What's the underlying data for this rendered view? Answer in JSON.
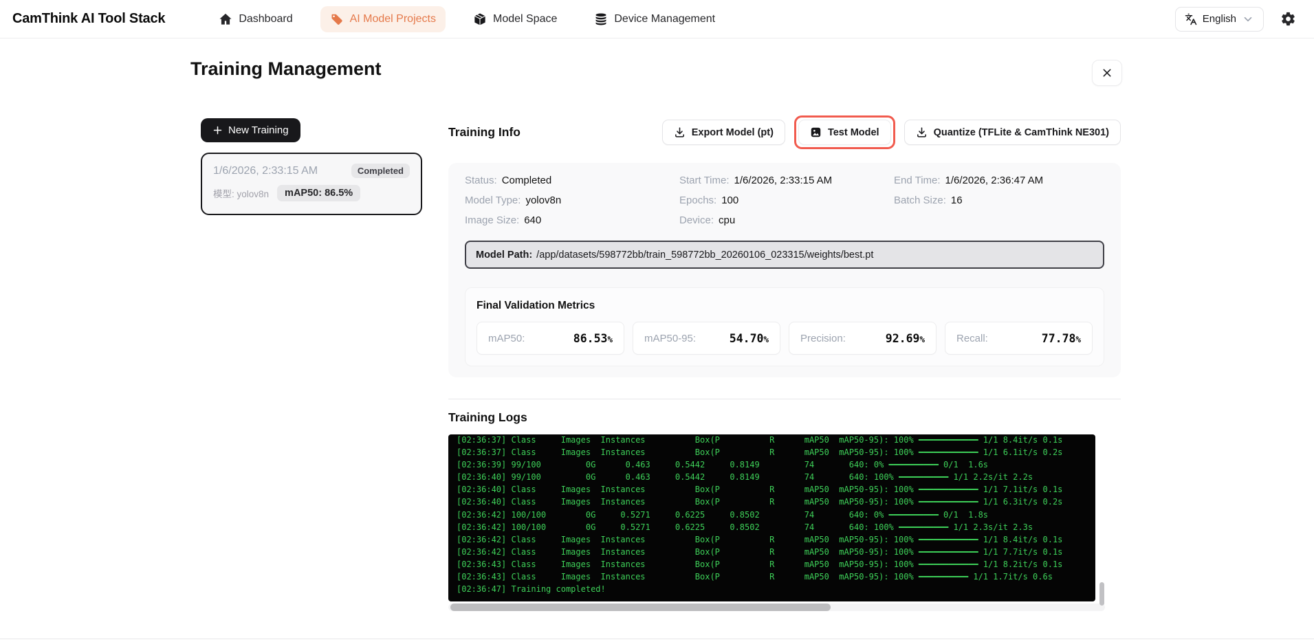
{
  "nav": {
    "logo": "CamThink AI Tool Stack",
    "items": [
      {
        "label": "Dashboard",
        "icon": "home-icon",
        "active": false
      },
      {
        "label": "AI Model Projects",
        "icon": "tag-icon",
        "active": true
      },
      {
        "label": "Model Space",
        "icon": "package-icon",
        "active": false
      },
      {
        "label": "Device Management",
        "icon": "database-icon",
        "active": false
      }
    ],
    "language": {
      "label": "English",
      "icon": "translate-icon"
    }
  },
  "page": {
    "title": "Training Management"
  },
  "icons": {
    "plus": "+",
    "close": "✕"
  },
  "sidebar": {
    "new_training_label": "New Training",
    "training_item": {
      "timestamp": "1/6/2026, 2:33:15 AM",
      "status": "Completed",
      "model_label": "模型: yolov8n",
      "map_badge": "mAP50: 86.5%"
    }
  },
  "training_info": {
    "title": "Training Info",
    "buttons": {
      "export": "Export Model (pt)",
      "test": "Test Model",
      "quantize": "Quantize (TFLite & CamThink NE301)"
    },
    "fields": [
      {
        "label": "Status:",
        "value": "Completed"
      },
      {
        "label": "Start Time:",
        "value": "1/6/2026, 2:33:15 AM"
      },
      {
        "label": "End Time:",
        "value": "1/6/2026, 2:36:47 AM"
      },
      {
        "label": "Model Type:",
        "value": "yolov8n"
      },
      {
        "label": "Epochs:",
        "value": "100"
      },
      {
        "label": "Batch Size:",
        "value": "16"
      },
      {
        "label": "Image Size:",
        "value": "640"
      },
      {
        "label": "Device:",
        "value": "cpu"
      }
    ],
    "model_path_label": "Model Path:",
    "model_path": "/app/datasets/598772bb/train_598772bb_20260106_023315/weights/best.pt",
    "metrics_title": "Final Validation Metrics",
    "metrics": [
      {
        "label": "mAP50:",
        "value": "86.53",
        "unit": "%"
      },
      {
        "label": "mAP50-95:",
        "value": "54.70",
        "unit": "%"
      },
      {
        "label": "Precision:",
        "value": "92.69",
        "unit": "%"
      },
      {
        "label": "Recall:",
        "value": "77.78",
        "unit": "%"
      }
    ]
  },
  "training_logs": {
    "title": "Training Logs",
    "lines": [
      "[02:36:37] Class     Images  Instances          Box(P          R      mAP50  mAP50-95): 100% ━━━━━━━━━━━━ 1/1 8.4it/s 0.1s",
      "[02:36:37] Class     Images  Instances          Box(P          R      mAP50  mAP50-95): 100% ━━━━━━━━━━━━ 1/1 6.1it/s 0.2s",
      "[02:36:39] 99/100         0G      0.463     0.5442     0.8149         74       640: 0% ━━━━━━━━━━ 0/1  1.6s",
      "[02:36:40] 99/100         0G      0.463     0.5442     0.8149         74       640: 100% ━━━━━━━━━━ 1/1 2.2s/it 2.2s",
      "[02:36:40] Class     Images  Instances          Box(P          R      mAP50  mAP50-95): 100% ━━━━━━━━━━━━ 1/1 7.1it/s 0.1s",
      "[02:36:40] Class     Images  Instances          Box(P          R      mAP50  mAP50-95): 100% ━━━━━━━━━━━━ 1/1 6.3it/s 0.2s",
      "[02:36:42] 100/100        0G     0.5271     0.6225     0.8502         74       640: 0% ━━━━━━━━━━ 0/1  1.8s",
      "[02:36:42] 100/100        0G     0.5271     0.6225     0.8502         74       640: 100% ━━━━━━━━━━ 1/1 2.3s/it 2.3s",
      "[02:36:42] Class     Images  Instances          Box(P          R      mAP50  mAP50-95): 100% ━━━━━━━━━━━━ 1/1 8.4it/s 0.1s",
      "[02:36:42] Class     Images  Instances          Box(P          R      mAP50  mAP50-95): 100% ━━━━━━━━━━━━ 1/1 7.7it/s 0.1s",
      "[02:36:43] Class     Images  Instances          Box(P          R      mAP50  mAP50-95): 100% ━━━━━━━━━━━━ 1/1 8.2it/s 0.1s",
      "[02:36:43] Class     Images  Instances          Box(P          R      mAP50  mAP50-95): 100% ━━━━━━━━━━ 1/1 1.7it/s 0.6s",
      "[02:36:47] Training completed!"
    ]
  },
  "colors": {
    "accent_orange": "#e5794a",
    "accent_orange_bg": "#fcf0e8",
    "highlight_red": "#f15b4e",
    "terminal_green": "#3ed159",
    "dark": "#18181b"
  }
}
